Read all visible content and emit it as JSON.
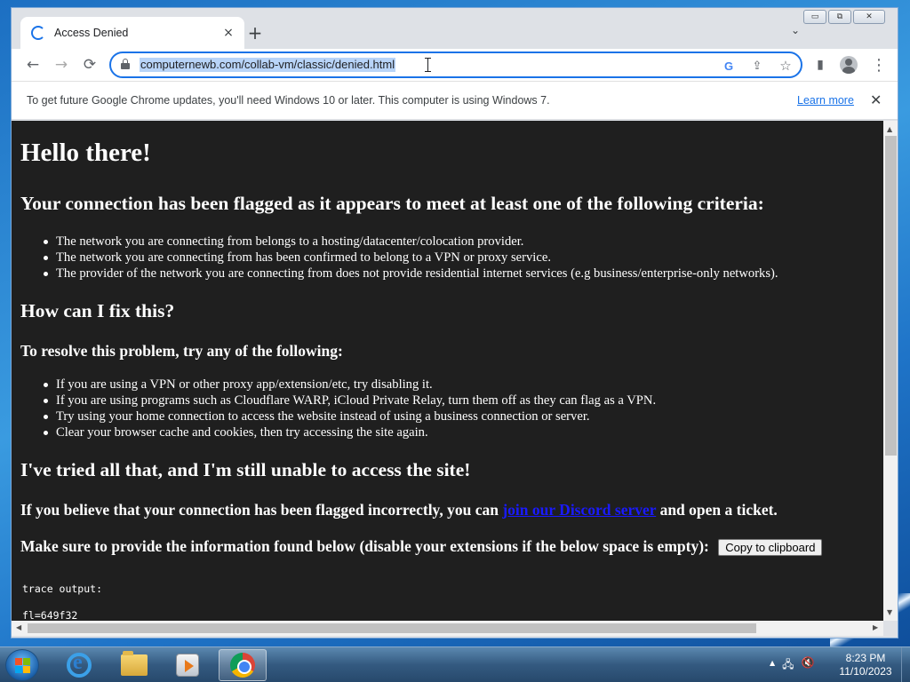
{
  "browser": {
    "tab_title": "Access Denied",
    "tab_close": "×",
    "new_tab": "+",
    "tab_search": "⌄",
    "window_controls": {
      "minimize": "▭",
      "maximize": "⧉",
      "close": "✕"
    },
    "url": "computernewb.com/collab-vm/classic/denied.html",
    "nav": {
      "back": "←",
      "forward": "→",
      "stop": "⟳"
    },
    "omnibox_icons": {
      "google": "G",
      "share": "⇪",
      "bookmark": "☆"
    },
    "toolbar_icons": {
      "sidepanel": "▮",
      "menu": "⋮"
    }
  },
  "infobar": {
    "message": "To get future Google Chrome updates, you'll need Windows 10 or later. This computer is using Windows 7.",
    "learn_more": "Learn more",
    "close": "✕"
  },
  "page": {
    "heading": "Hello there!",
    "flagged_heading": "Your connection has been flagged as it appears to meet at least one of the following criteria:",
    "criteria": [
      "The network you are connecting from belongs to a hosting/datacenter/colocation provider.",
      "The network you are connecting from has been confirmed to belong to a VPN or proxy service.",
      "The provider of the network you are connecting from does not provide residential internet services (e.g business/enterprise-only networks)."
    ],
    "fix_heading": "How can I fix this?",
    "resolve_heading": "To resolve this problem, try any of the following:",
    "fixes": [
      "If you are using a VPN or other proxy app/extension/etc, try disabling it.",
      "If you are using programs such as Cloudflare WARP, iCloud Private Relay, turn them off as they can flag as a VPN.",
      "Try using your home connection to access the website instead of using a business connection or server.",
      "Clear your browser cache and cookies, then try accessing the site again."
    ],
    "tried_heading": "I've tried all that, and I'm still unable to access the site!",
    "incorrect_before": "If you believe that your connection has been flagged incorrectly, you can ",
    "discord_link": "join our Discord server",
    "incorrect_after": " and open a ticket.",
    "provide_info": "Make sure to provide the information found below (disable your extensions if the below space is empty):",
    "copy_button": "Copy to clipboard",
    "trace_label": "trace output:",
    "trace_line": "fl=649f32"
  },
  "taskbar": {
    "time": "8:23 PM",
    "date": "11/10/2023",
    "tray": {
      "arrow": "▲",
      "network": "🖧",
      "volume": "🔇"
    }
  },
  "colors": {
    "page_background": "#1f1f1f",
    "link": "#1a1aff",
    "accent": "#1a73e8"
  }
}
